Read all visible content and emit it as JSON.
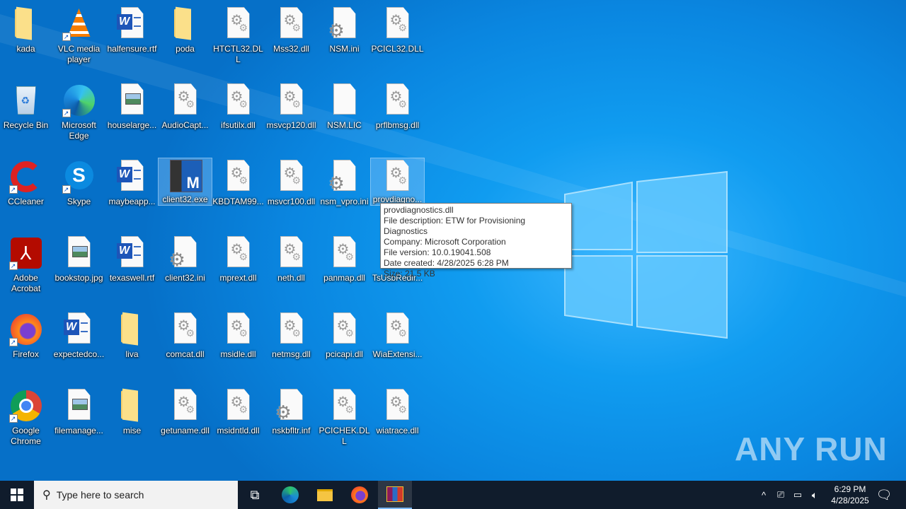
{
  "desktop": {
    "columns": [
      [
        {
          "label": "kada",
          "type": "folder"
        },
        {
          "label": "Recycle Bin",
          "type": "recycle"
        },
        {
          "label": "CCleaner",
          "type": "ccleaner"
        },
        {
          "label": "Adobe Acrobat",
          "type": "acrobat"
        },
        {
          "label": "Firefox",
          "type": "firefox"
        },
        {
          "label": "Google Chrome",
          "type": "chrome"
        }
      ],
      [
        {
          "label": "VLC media player",
          "type": "vlc"
        },
        {
          "label": "Microsoft Edge",
          "type": "edge"
        },
        {
          "label": "Skype",
          "type": "skype"
        },
        {
          "label": "bookstop.jpg",
          "type": "image"
        },
        {
          "label": "expectedco...",
          "type": "word"
        },
        {
          "label": "filemanage...",
          "type": "image"
        }
      ],
      [
        {
          "label": "halfensure.rtf",
          "type": "word"
        },
        {
          "label": "houselarge...",
          "type": "image"
        },
        {
          "label": "maybeapp...",
          "type": "word"
        },
        {
          "label": "texaswell.rtf",
          "type": "word"
        },
        {
          "label": "liva",
          "type": "folder"
        },
        {
          "label": "mise",
          "type": "folder"
        }
      ],
      [
        {
          "label": "poda",
          "type": "folder"
        },
        {
          "label": "AudioCapt...",
          "type": "dll"
        },
        {
          "label": "client32.exe",
          "type": "exe",
          "selected": true
        },
        {
          "label": "client32.ini",
          "type": "ini"
        },
        {
          "label": "comcat.dll",
          "type": "dll"
        },
        {
          "label": "getuname.dll",
          "type": "dll"
        }
      ],
      [
        {
          "label": "HTCTL32.DLL",
          "type": "dll"
        },
        {
          "label": "ifsutilx.dll",
          "type": "dll"
        },
        {
          "label": "KBDTAM99...",
          "type": "dll"
        },
        {
          "label": "mprext.dll",
          "type": "dll"
        },
        {
          "label": "msidle.dll",
          "type": "dll"
        },
        {
          "label": "msidntld.dll",
          "type": "dll"
        }
      ],
      [
        {
          "label": "Mss32.dll",
          "type": "dll"
        },
        {
          "label": "msvcp120.dll",
          "type": "dll"
        },
        {
          "label": "msvcr100.dll",
          "type": "dll"
        },
        {
          "label": "neth.dll",
          "type": "dll"
        },
        {
          "label": "netmsg.dll",
          "type": "dll"
        },
        {
          "label": "nskbfltr.inf",
          "type": "ini"
        }
      ],
      [
        {
          "label": "NSM.ini",
          "type": "ini"
        },
        {
          "label": "NSM.LIC",
          "type": "blank"
        },
        {
          "label": "nsm_vpro.ini",
          "type": "ini"
        },
        {
          "label": "panmap.dll",
          "type": "dll"
        },
        {
          "label": "pcicapi.dll",
          "type": "dll"
        },
        {
          "label": "PCICHEK.DLL",
          "type": "dll"
        }
      ],
      [
        {
          "label": "PCICL32.DLL",
          "type": "dll"
        },
        {
          "label": "prflbmsg.dll",
          "type": "dll"
        },
        {
          "label": "provdiagno...",
          "type": "dll",
          "selected": true
        },
        {
          "label": "TsUsbRedir...",
          "type": "dll"
        },
        {
          "label": "WiaExtensi...",
          "type": "dll"
        },
        {
          "label": "wiatrace.dll",
          "type": "dll"
        }
      ]
    ]
  },
  "tooltip": {
    "lines": [
      "provdiagnostics.dll",
      "File description: ETW for Provisioning Diagnostics",
      "Company: Microsoft Corporation",
      "File version: 10.0.19041.508",
      "Date created: 4/28/2025 6:28 PM",
      "Size: 21.5 KB"
    ]
  },
  "taskbar": {
    "search_placeholder": "Type here to search",
    "time": "6:29 PM",
    "date": "4/28/2025"
  },
  "watermark": "ANY RUN"
}
